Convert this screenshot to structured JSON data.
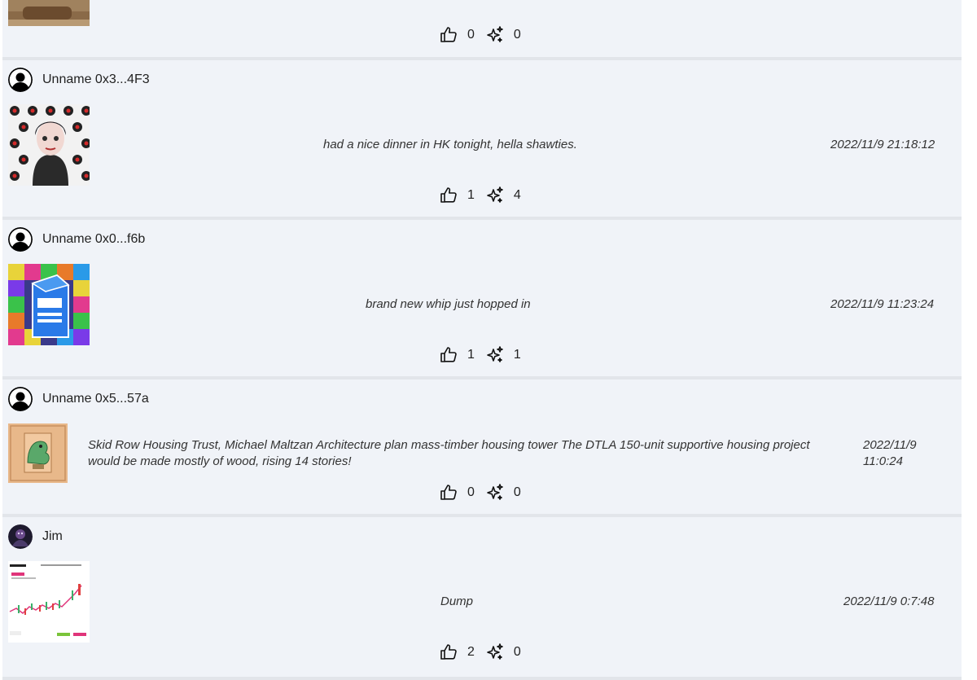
{
  "posts": [
    {
      "username": "",
      "message": "",
      "timestamp": "",
      "likes": "0",
      "sparks": "0"
    },
    {
      "username": "Unname 0x3...4F3",
      "message": "had a nice dinner in HK tonight, hella shawties.",
      "timestamp": "2022/11/9 21:18:12",
      "likes": "1",
      "sparks": "4"
    },
    {
      "username": "Unname 0x0...f6b",
      "message": "brand new whip just hopped in",
      "timestamp": "2022/11/9 11:23:24",
      "likes": "1",
      "sparks": "1"
    },
    {
      "username": "Unname 0x5...57a",
      "message": "Skid Row Housing Trust, Michael Maltzan Architecture plan mass-timber housing tower The DTLA 150-unit supportive housing project would be made mostly of wood, rising 14 stories!",
      "timestamp": "2022/11/9 11:0:24",
      "likes": "0",
      "sparks": "0"
    },
    {
      "username": "Jim",
      "message": "Dump",
      "timestamp": "2022/11/9 0:7:48",
      "likes": "2",
      "sparks": "0"
    }
  ],
  "icons": {
    "like": "thumbs-up-icon",
    "spark": "sparkles-icon",
    "avatar": "user-avatar-icon"
  },
  "colors": {
    "card_bg": "#f0f3f8",
    "divider": "#e2e5ea",
    "text": "#222222"
  }
}
